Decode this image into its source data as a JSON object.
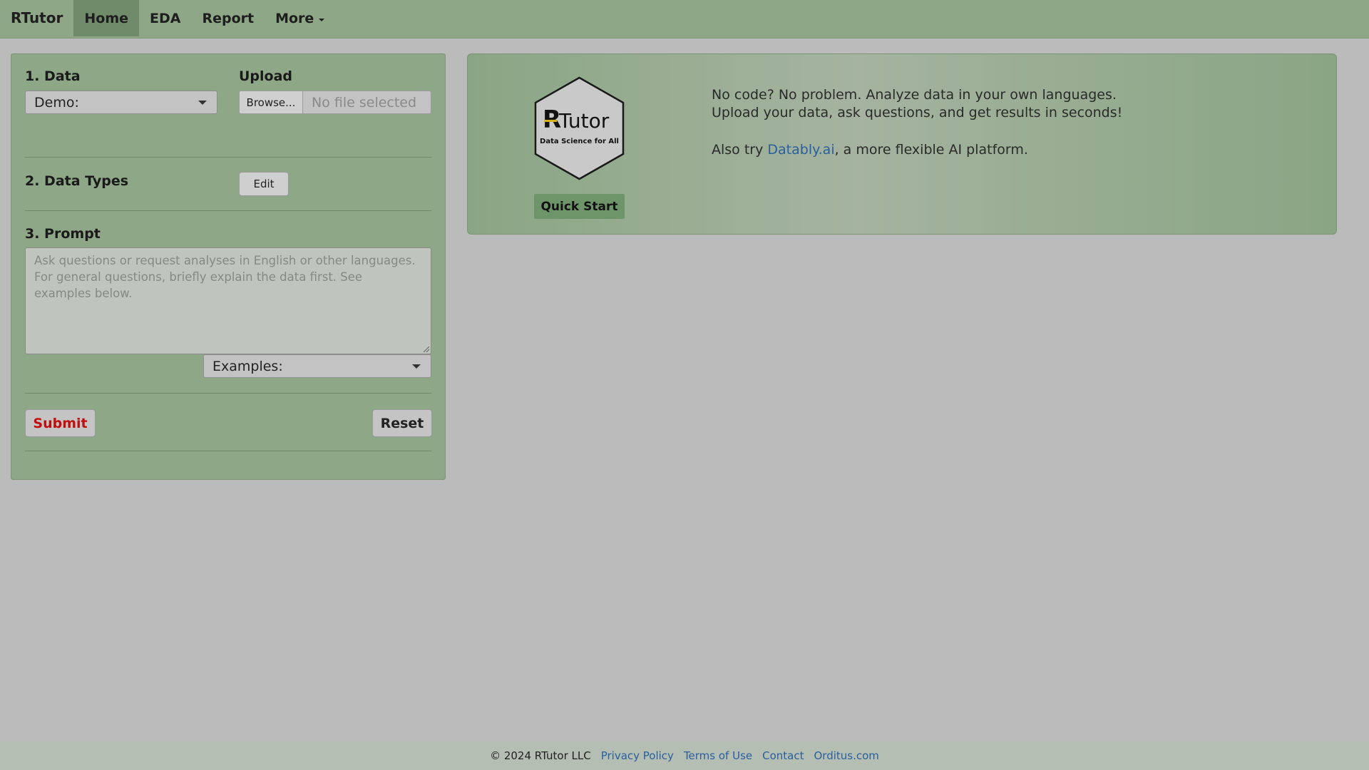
{
  "navbar": {
    "brand": "RTutor",
    "items": [
      {
        "label": "Home"
      },
      {
        "label": "EDA"
      },
      {
        "label": "Report"
      },
      {
        "label": "More"
      }
    ]
  },
  "data_section": {
    "title": "1. Data",
    "demo_select": "Demo:",
    "upload_label": "Upload",
    "browse_label": "Browse...",
    "file_placeholder": "No file selected"
  },
  "types_section": {
    "title": "2. Data Types",
    "edit_label": "Edit"
  },
  "prompt_section": {
    "title": "3. Prompt",
    "placeholder": "Ask questions or request analyses in English or other languages. For general questions, briefly explain the data first. See examples below.",
    "examples_select": "Examples:"
  },
  "actions": {
    "submit_label": "Submit",
    "reset_label": "Reset"
  },
  "banner": {
    "logo_text": "Tutor",
    "logo_tagline": "Data Science for All",
    "quick_start": "Quick Start",
    "line1": "No code? No problem. Analyze data in your own languages.",
    "line2": "Upload your data, ask questions, and get results in seconds!",
    "also_try_prefix": "Also try ",
    "also_try_link": "Datably.ai",
    "also_try_suffix": ", a more flexible AI platform."
  },
  "footer": {
    "copyright": "© 2024 RTutor LLC",
    "links": [
      "Privacy Policy",
      "Terms of Use",
      "Contact",
      "Orditus.com"
    ]
  },
  "colors": {
    "panel_green": "#8da787",
    "active_tab": "#6f8b6a",
    "submit_red": "#c10f0f",
    "link_blue": "#2a5f9e"
  }
}
